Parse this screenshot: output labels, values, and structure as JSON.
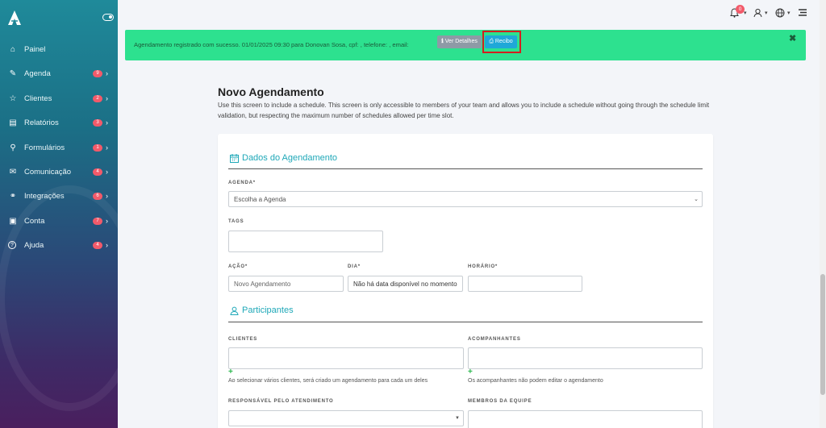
{
  "sidebar": {
    "items": [
      {
        "label": "Painel",
        "icon": "home-icon",
        "badge": "",
        "chevron": false
      },
      {
        "label": "Agenda",
        "icon": "edit-icon",
        "badge": "9",
        "chevron": true
      },
      {
        "label": "Clientes",
        "icon": "star-icon",
        "badge": "2",
        "chevron": true
      },
      {
        "label": "Relatórios",
        "icon": "book-icon",
        "badge": "3",
        "chevron": true
      },
      {
        "label": "Formulários",
        "icon": "search-icon",
        "badge": "1",
        "chevron": true
      },
      {
        "label": "Comunicação",
        "icon": "mail-icon",
        "badge": "4",
        "chevron": true
      },
      {
        "label": "Integrações",
        "icon": "link-icon",
        "badge": "6",
        "chevron": true
      },
      {
        "label": "Conta",
        "icon": "briefcase-icon",
        "badge": "7",
        "chevron": true
      },
      {
        "label": "Ajuda",
        "icon": "help-icon",
        "badge": "4",
        "chevron": true
      }
    ]
  },
  "topbar": {
    "notifications_count": "0"
  },
  "alert": {
    "message": "Agendamento registrado com sucesso. 01/01/2025 09:30 para Donovan Sosa, cpf: , telefone: , email:",
    "details_label": "Ver Detalhes",
    "receipt_label": "Recibo",
    "close_label": "✖"
  },
  "page": {
    "title": "Novo Agendamento",
    "description": "Use this screen to include a schedule. This screen is only accessible to members of your team and allows you to include a schedule without going through the schedule limit validation, but respecting the maximum number of schedules allowed per time slot."
  },
  "form": {
    "section_schedule": "Dados do Agendamento",
    "agenda_label": "AGENDA*",
    "agenda_value": "Escolha a Agenda",
    "tags_label": "TAGS",
    "acao_label": "AÇÃO*",
    "acao_placeholder": "Novo Agendamento",
    "dia_label": "DIA*",
    "dia_value": "Não há data disponível no momento",
    "horario_label": "HORÁRIO*",
    "section_participants": "Participantes",
    "clientes_label": "CLIENTES",
    "clientes_help": "Ao selecionar vários clientes, será criado um agendamento para cada um deles",
    "acompanhantes_label": "ACOMPANHANTES",
    "acompanhantes_help": "Os acompanhantes não podem editar o agendamento",
    "responsavel_label": "RESPONSÁVEL PELO ATENDIMENTO",
    "membros_label": "MEMBROS DA EQUIPE"
  }
}
